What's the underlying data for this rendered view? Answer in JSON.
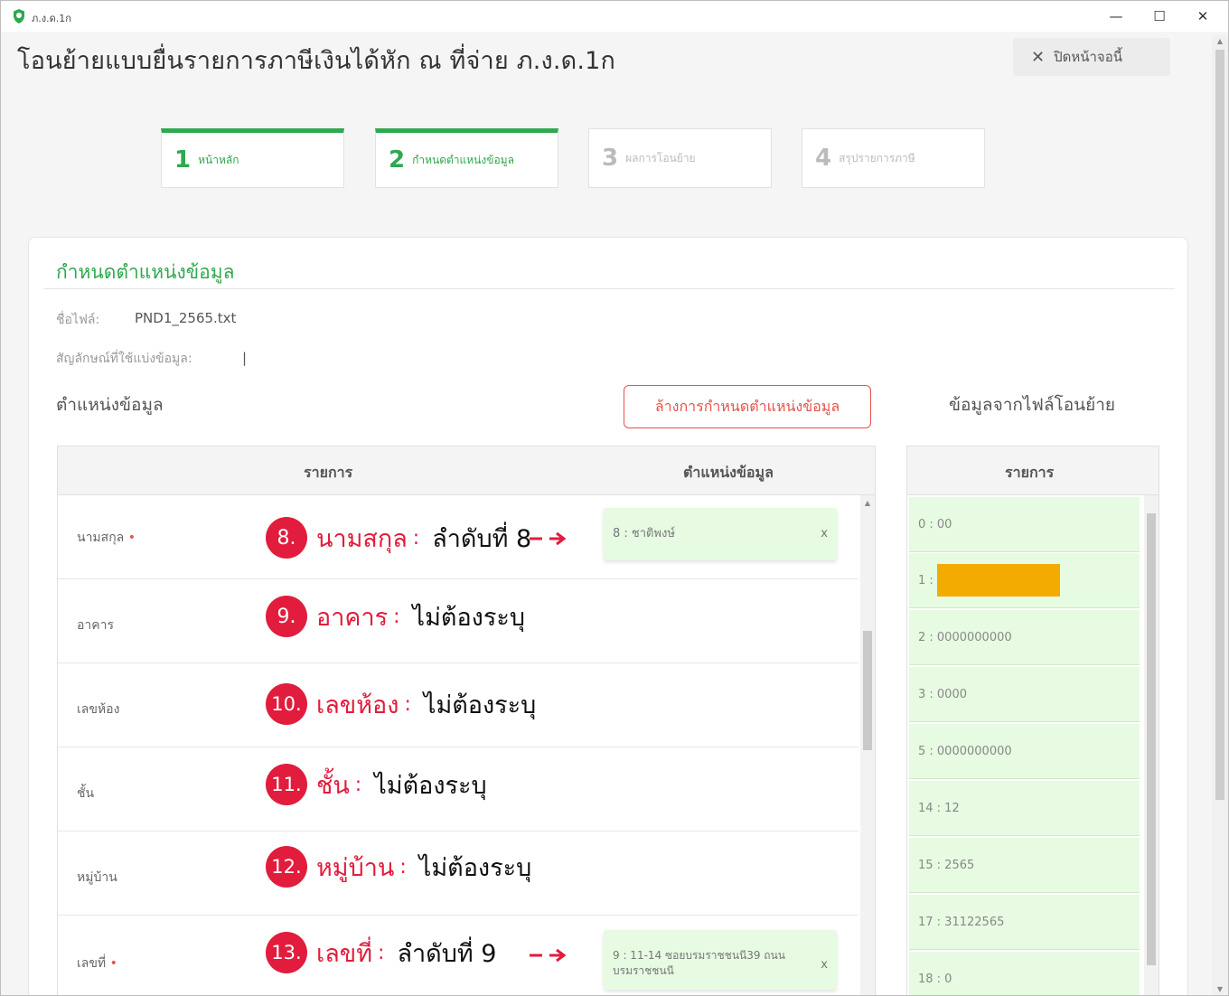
{
  "window": {
    "title": "ภ.ง.ด.1ก",
    "minimize": "—",
    "maximize": "☐",
    "close": "✕"
  },
  "page": {
    "title": "โอนย้ายแบบยื่นรายการภาษีเงินได้หัก ณ ที่จ่าย ภ.ง.ด.1ก",
    "close_button": "ปิดหน้าจอนี้"
  },
  "steps": [
    {
      "num": "1",
      "label": "หน้าหลัก"
    },
    {
      "num": "2",
      "label": "กำหนดตำแหน่งข้อมูล"
    },
    {
      "num": "3",
      "label": "ผลการโอนย้าย"
    },
    {
      "num": "4",
      "label": "สรุปรายการภาษี"
    }
  ],
  "section": {
    "title": "กำหนดตำแหน่งข้อมูล",
    "file_label": "ชื่อไฟล์:",
    "file_name": "PND1_2565.txt",
    "delimiter_label": "สัญลักษณ์ที่ใช้แบ่งข้อมูล:",
    "delimiter_value": "|",
    "left_title": "ตำแหน่งข้อมูล",
    "reset_button": "ล้างการกำหนดตำแหน่งข้อมูล",
    "right_title": "ข้อมูลจากไฟล์โอนย้าย"
  },
  "left_table": {
    "col_item": "รายการ",
    "col_position": "ตำแหน่งข้อมูล",
    "rows": [
      {
        "label": "นามสกุล",
        "required": "•",
        "badge": "8.",
        "field": "นามสกุล",
        "colon": ":",
        "rule": "ลำดับที่ 8",
        "chip": "8 : ชาติพงษ์",
        "chip_x": "x"
      },
      {
        "label": "อาคาร",
        "badge": "9.",
        "field": "อาคาร",
        "colon": ":",
        "rule": "ไม่ต้องระบุ"
      },
      {
        "label": "เลขห้อง",
        "badge": "10.",
        "field": "เลขห้อง",
        "colon": ":",
        "rule": "ไม่ต้องระบุ"
      },
      {
        "label": "ชั้น",
        "badge": "11.",
        "field": "ชั้น",
        "colon": ":",
        "rule": "ไม่ต้องระบุ"
      },
      {
        "label": "หมู่บ้าน",
        "badge": "12.",
        "field": "หมู่บ้าน",
        "colon": ":",
        "rule": "ไม่ต้องระบุ"
      },
      {
        "label": "เลขที่",
        "required": "•",
        "badge": "13.",
        "field": "เลขที่",
        "colon": ":",
        "rule": "ลำดับที่ 9",
        "chip": "9 : 11-14 ซอยบรมราชชนนี39 ถนนบรมราชชนนี",
        "chip_x": "x"
      }
    ]
  },
  "right_table": {
    "col_item": "รายการ",
    "rows": [
      "0 : 00",
      "1 :",
      "2 : 0000000000",
      "3 : 0000",
      "5 : 0000000000",
      "14 : 12",
      "15 : 2565",
      "17 : 31122565",
      "18 : 0"
    ]
  },
  "colors": {
    "accent_green": "#2fa84f",
    "annotation_red": "#e21c3c",
    "reset_red": "#e5534b",
    "chip_bg": "#e6fbe1",
    "redaction": "#f4ab00"
  }
}
